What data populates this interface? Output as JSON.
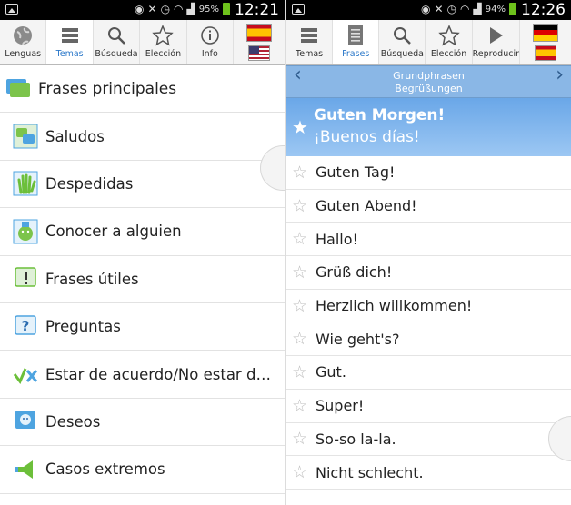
{
  "left": {
    "status": {
      "battery": "95%",
      "time": "12:21"
    },
    "toolbar": [
      {
        "label": "Lenguas",
        "icon": "globe-icon"
      },
      {
        "label": "Temas",
        "icon": "list-icon",
        "active": true
      },
      {
        "label": "Búsqueda",
        "icon": "search-icon"
      },
      {
        "label": "Elección",
        "icon": "star-icon"
      },
      {
        "label": "Info",
        "icon": "info-icon"
      }
    ],
    "header": "Frases principales",
    "items": [
      "Saludos",
      "Despedidas",
      "Conocer a alguien",
      "Frases útiles",
      "Preguntas",
      "Estar de acuerdo/No estar de a...",
      "Deseos",
      "Casos extremos"
    ]
  },
  "right": {
    "status": {
      "battery": "94%",
      "time": "12:26"
    },
    "toolbar": [
      {
        "label": "Temas",
        "icon": "list-icon"
      },
      {
        "label": "Frases",
        "icon": "document-icon",
        "active": true
      },
      {
        "label": "Búsqueda",
        "icon": "search-icon"
      },
      {
        "label": "Elección",
        "icon": "star-icon"
      },
      {
        "label": "Reproducir",
        "icon": "play-icon"
      }
    ],
    "nav": {
      "line1": "Grundphrasen",
      "line2": "Begrüßungen"
    },
    "selected": {
      "de": "Guten Morgen!",
      "es": "¡Buenos días!"
    },
    "phrases": [
      "Guten Tag!",
      "Guten Abend!",
      "Hallo!",
      "Grüß dich!",
      "Herzlich willkommen!",
      "Wie geht's?",
      "Gut.",
      "Super!",
      "So-so la-la.",
      "Nicht schlecht."
    ]
  },
  "colors": {
    "accent": "#3a8fe0",
    "selected_bg": "#6aa7e8",
    "nav_bg": "#8ab7e6"
  }
}
